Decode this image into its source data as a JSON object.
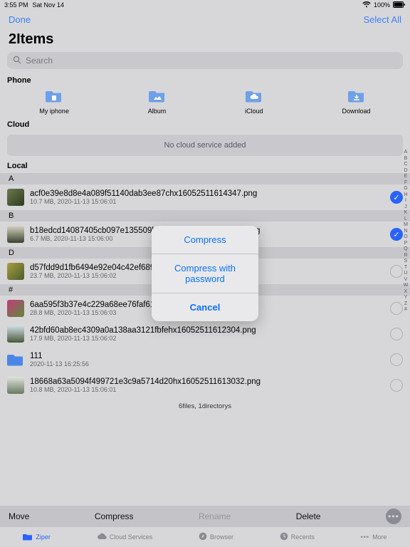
{
  "status": {
    "time": "3:55 PM",
    "date": "Sat Nov 14",
    "battery": "100%"
  },
  "nav": {
    "done": "Done",
    "selectall": "Select All"
  },
  "title": "2Items",
  "search": {
    "placeholder": "Search"
  },
  "sections": {
    "phone": "Phone",
    "cloud": "Cloud",
    "local": "Local"
  },
  "phone": {
    "items": [
      {
        "label": "My iphone"
      },
      {
        "label": "Album"
      },
      {
        "label": "iCloud"
      },
      {
        "label": "Download"
      }
    ]
  },
  "cloud": {
    "empty": "No cloud service added"
  },
  "groups": [
    {
      "letter": "A",
      "rows": [
        {
          "name": "acf0e39e8d8e4a089f51140dab3ee87chx16052511614347.png",
          "meta": "10.7 MB, 2020-11-13 15:06:01",
          "selected": true,
          "thumb": "linear-gradient(135deg,#6a7a52,#2d3a1c)"
        }
      ]
    },
    {
      "letter": "B",
      "rows": [
        {
          "name": "b18edcd14087405cb097e135509b8f2ahx16052511602040.png",
          "meta": "6.7 MB, 2020-11-13 15:06:00",
          "selected": true,
          "thumb": "linear-gradient(180deg,#d7d2c2,#3a4431)"
        }
      ]
    },
    {
      "letter": "D",
      "rows": [
        {
          "name": "d57fdd9d1fb6494e92e04c42ef689b08hx16052511602341.png",
          "meta": "23.7 MB, 2020-11-13 15:06:02",
          "selected": false,
          "thumb": "linear-gradient(135deg,#a9a03f,#4d5a2e)"
        }
      ]
    },
    {
      "letter": "#",
      "rows": [
        {
          "name": "6aa595f3b37e4c229a68ee76faf61627hx16052511602712.png",
          "meta": "28.8 MB, 2020-11-13 15:06:03",
          "selected": false,
          "thumb": "linear-gradient(135deg,#c23b7a,#5d8a3a)"
        },
        {
          "name": "42bfd60ab8ec4309a0a138aa3121fbfehx16052511612304.png",
          "meta": "17.9 MB, 2020-11-13 15:06:02",
          "selected": false,
          "thumb": "linear-gradient(180deg,#d0e0e6,#4a5a3a)"
        },
        {
          "name": "111",
          "meta": "2020-11-13 16:25:56",
          "selected": false,
          "folder": true
        },
        {
          "name": "18668a63a5094f499721e3c9a5714d20hx16052511613032.png",
          "meta": "10.8 MB, 2020-11-13 15:06:01",
          "selected": false,
          "thumb": "linear-gradient(180deg,#e0e4dc,#6a7a62)"
        }
      ]
    }
  ],
  "footer_count": "6files, 1directorys",
  "index_letters": [
    "A",
    "B",
    "C",
    "D",
    "E",
    "F",
    "G",
    "H",
    "I",
    "J",
    "K",
    "L",
    "M",
    "N",
    "O",
    "P",
    "Q",
    "R",
    "S",
    "T",
    "U",
    "V",
    "W",
    "X",
    "Y",
    "Z",
    "#"
  ],
  "toolbar": {
    "move": "Move",
    "compress": "Compress",
    "rename": "Rename",
    "delete": "Delete"
  },
  "tabs": {
    "ziper": "Ziper",
    "cloud": "Cloud Services",
    "browser": "Browser",
    "recents": "Recents",
    "more": "More"
  },
  "sheet": {
    "compress": "Compress",
    "compress_pw": "Compress with password",
    "cancel": "Cancel"
  }
}
